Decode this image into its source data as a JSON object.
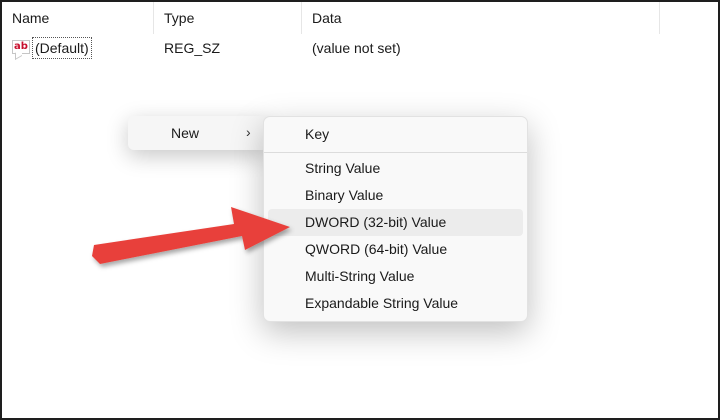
{
  "columns": {
    "name": "Name",
    "type": "Type",
    "data": "Data"
  },
  "rows": [
    {
      "icon": "ab",
      "name": "(Default)",
      "type": "REG_SZ",
      "data": "(value not set)"
    }
  ],
  "context_menu": {
    "new_label": "New",
    "chevron": "›"
  },
  "submenu": {
    "items": [
      {
        "label": "Key"
      },
      {
        "label": "String Value"
      },
      {
        "label": "Binary Value"
      },
      {
        "label": "DWORD (32-bit) Value"
      },
      {
        "label": "QWORD (64-bit) Value"
      },
      {
        "label": "Multi-String Value"
      },
      {
        "label": "Expandable String Value"
      }
    ],
    "highlighted": "DWORD (32-bit) Value"
  },
  "colors": {
    "annotation_arrow": "#e8413a",
    "icon_text": "#c8102e"
  },
  "icons": {
    "value_icon": "string-value-icon",
    "chevron": "chevron-right-icon",
    "annotation": "red-arrow-annotation"
  }
}
